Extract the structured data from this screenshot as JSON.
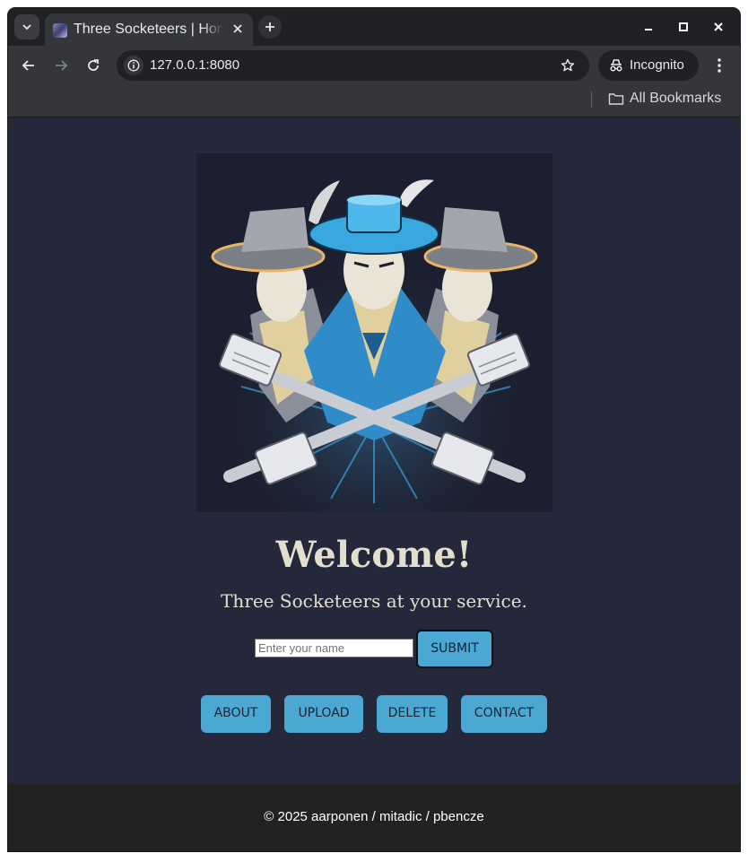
{
  "browser": {
    "tab_title": "Three Socketeers | Home",
    "url": "127.0.0.1:8080",
    "incognito_label": "Incognito",
    "bookmarks_label": "All Bookmarks"
  },
  "page": {
    "heading": "Welcome!",
    "subtitle": "Three Socketeers at your service.",
    "name_placeholder": "Enter your name",
    "submit_label": "SUBMIT",
    "nav": {
      "about": "ABOUT",
      "upload": "UPLOAD",
      "delete": "DELETE",
      "contact": "CONTACT"
    },
    "footer": "© 2025 aarponen / mitadic / pbencze"
  },
  "colors": {
    "page_background": "#25283a",
    "accent": "#4aa8d3",
    "heading_text": "#e2dfcf",
    "footer_background": "#222222"
  },
  "icons": [
    "tab-search-icon",
    "site-favicon",
    "close-icon",
    "plus-icon",
    "minimize-icon",
    "maximize-icon",
    "window-close-icon",
    "back-icon",
    "forward-icon",
    "reload-icon",
    "info-icon",
    "star-icon",
    "incognito-icon",
    "more-vert-icon",
    "folder-icon"
  ]
}
